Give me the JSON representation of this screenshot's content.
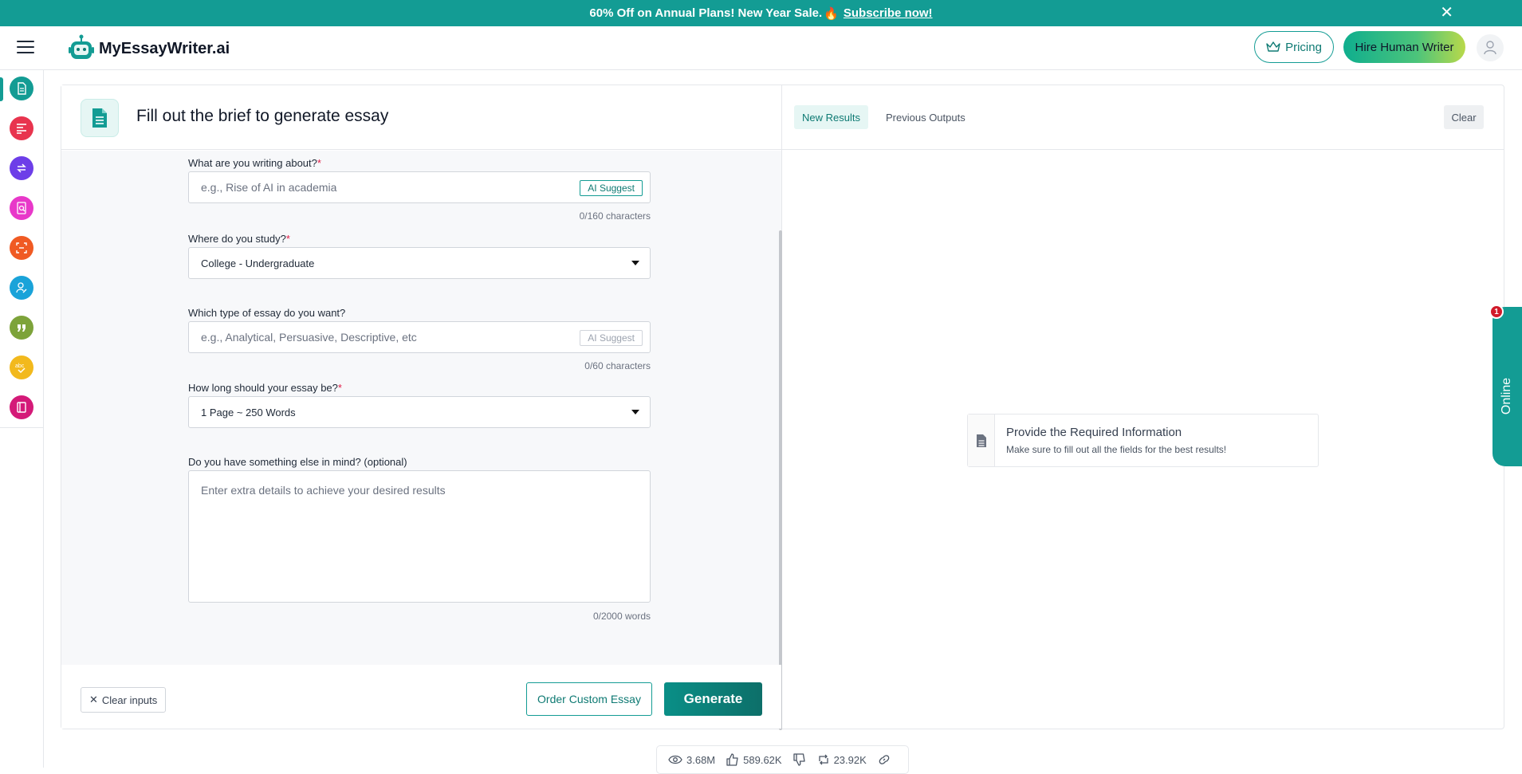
{
  "banner": {
    "text": "60% Off on Annual Plans! New Year Sale.",
    "emoji": "🔥",
    "link_label": "Subscribe now!",
    "close_glyph": "✕"
  },
  "header": {
    "logo_text": "MyEssayWriter.ai",
    "pricing_label": "Pricing",
    "hire_label": "Hire Human Writer"
  },
  "sidebar": {
    "icons": [
      {
        "name": "essay-writer-icon",
        "color": "#139c94"
      },
      {
        "name": "paragraph-icon",
        "color": "#e8344e"
      },
      {
        "name": "paraphrase-icon",
        "color": "#6d3ee8"
      },
      {
        "name": "plagiarism-checker-icon",
        "color": "#e838c9"
      },
      {
        "name": "summarizer-icon",
        "color": "#f05a23"
      },
      {
        "name": "humanizer-icon",
        "color": "#1aa3d9"
      },
      {
        "name": "citation-icon",
        "color": "#7da33a"
      },
      {
        "name": "grammar-checker-icon",
        "color": "#f2b91d"
      },
      {
        "name": "book-icon",
        "color": "#d41a78"
      }
    ]
  },
  "form": {
    "title": "Fill out the brief to generate essay",
    "topic_label": "What are you writing about?",
    "topic_placeholder": "e.g., Rise of AI in academia",
    "topic_counter": "0/160 characters",
    "ai_suggest": "AI Suggest",
    "study_label": "Where do you study?",
    "study_value": "College - Undergraduate",
    "type_label": "Which type of essay do you want?",
    "type_placeholder": "e.g., Analytical, Persuasive, Descriptive, etc",
    "type_counter": "0/60 characters",
    "length_label": "How long should your essay be?",
    "length_value": "1 Page ~ 250 Words",
    "extra_label": "Do you have something else in mind? (optional)",
    "extra_placeholder": "Enter extra details to achieve your desired results",
    "extra_counter": "0/2000 words",
    "required_mark": "*",
    "clear_inputs": "Clear inputs",
    "order_label": "Order Custom Essay",
    "generate_label": "Generate"
  },
  "results": {
    "tab_new": "New Results",
    "tab_previous": "Previous Outputs",
    "clear_label": "Clear",
    "info_title": "Provide the Required Information",
    "info_sub": "Make sure to fill out all the fields for the best results!"
  },
  "chat": {
    "label": "Online",
    "badge": "1"
  },
  "stats": {
    "views": "3.68M",
    "likes": "589.62K",
    "shares": "23.92K"
  },
  "colors": {
    "brand": "#139c94",
    "required": "#e11d48"
  }
}
